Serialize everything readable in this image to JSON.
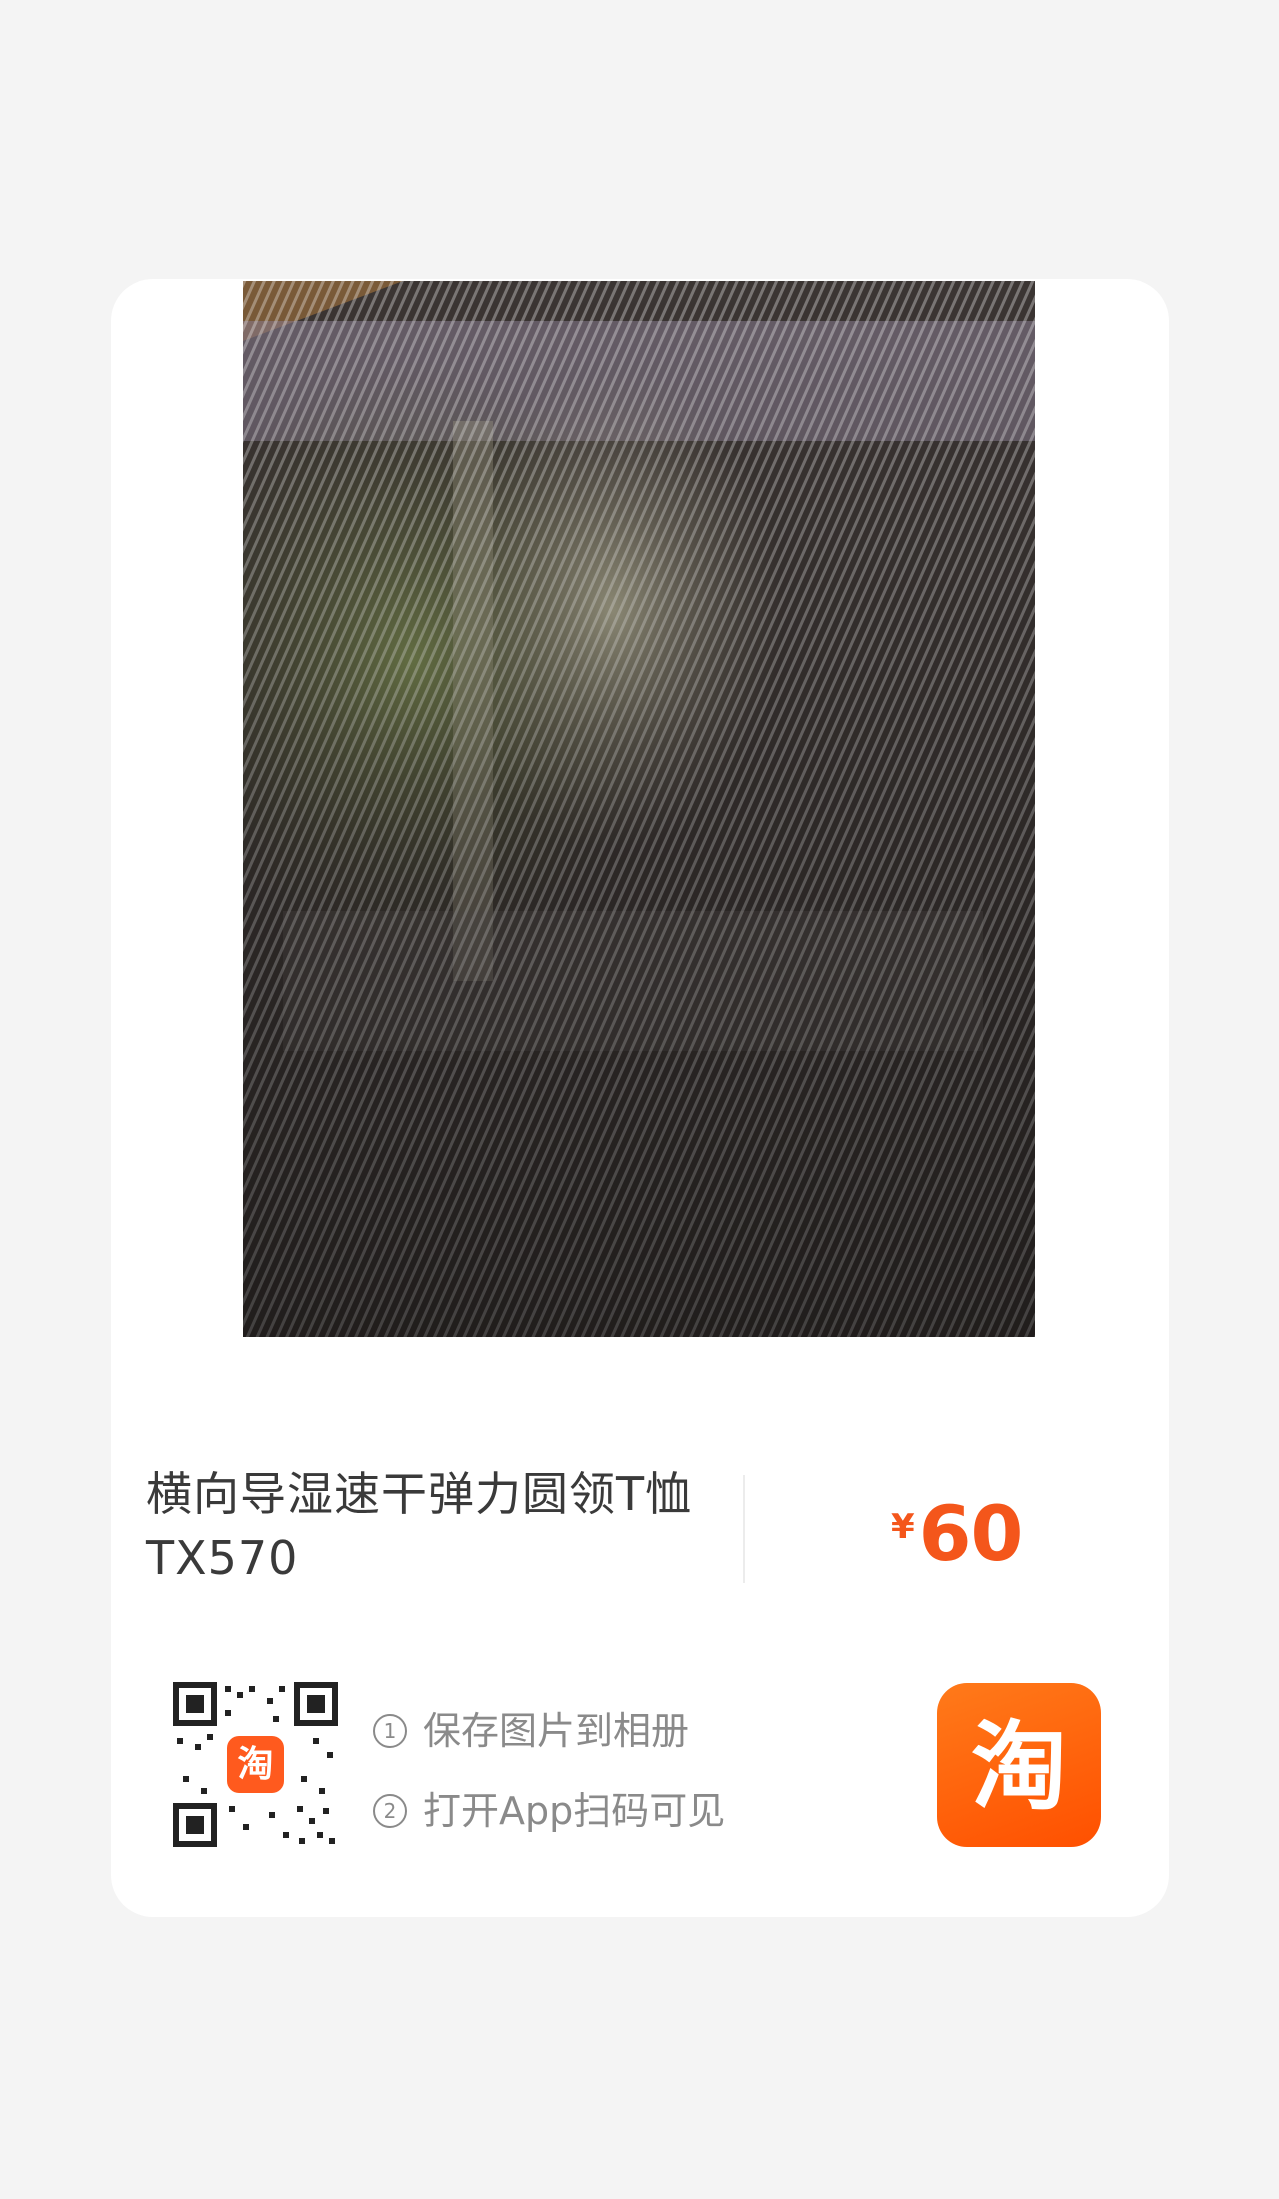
{
  "product": {
    "title_line1": "横向导湿速干弹力圆领T恤",
    "title_line2": "TX570",
    "price_currency": "¥",
    "price_value": "60"
  },
  "share": {
    "qr_badge_text": "淘",
    "steps": [
      {
        "num": "1",
        "text": "保存图片到相册"
      },
      {
        "num": "2",
        "text": "打开App扫码可见"
      }
    ],
    "app_logo_text": "淘"
  },
  "colors": {
    "price": "#f4561b",
    "brand_orange": "#ff5000",
    "background": "#f4f4f4",
    "card": "#ffffff"
  },
  "icons": {
    "qr": "qr-code-icon",
    "app": "taobao-app-icon"
  }
}
